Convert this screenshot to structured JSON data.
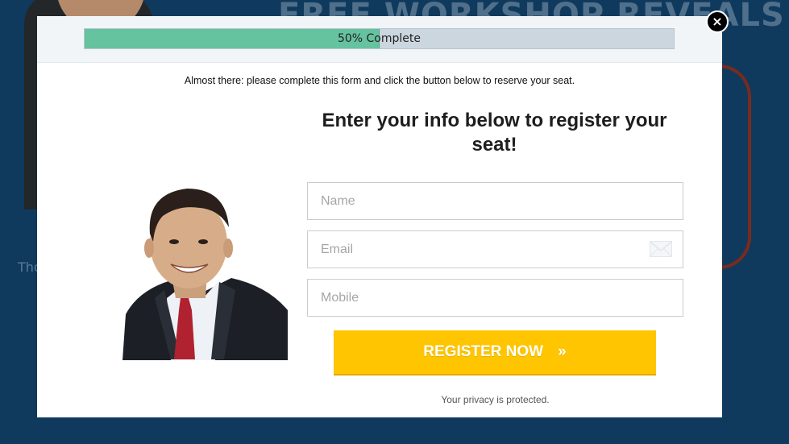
{
  "background": {
    "headline": "FREE WORKSHOP REVEALS",
    "caption": "Tho"
  },
  "modal": {
    "progress": {
      "fraction": 0.5,
      "label": "50% Complete"
    },
    "close_label": "×",
    "instruction": "Almost there: please complete this form and click the button below to reserve your seat.",
    "heading": "Enter your info below to register your seat!",
    "form": {
      "name": {
        "placeholder": "Name",
        "value": ""
      },
      "email": {
        "placeholder": "Email",
        "value": "",
        "icon": "envelope-icon"
      },
      "mobile": {
        "placeholder": "Mobile",
        "value": ""
      }
    },
    "submit": {
      "label": "REGISTER NOW",
      "chevron": "»"
    },
    "privacy": "Your privacy is protected."
  },
  "colors": {
    "page_background": "#0f3a5e",
    "progress_fill": "#65c39f",
    "progress_track": "#ccd6df",
    "button": "#ffc500"
  }
}
